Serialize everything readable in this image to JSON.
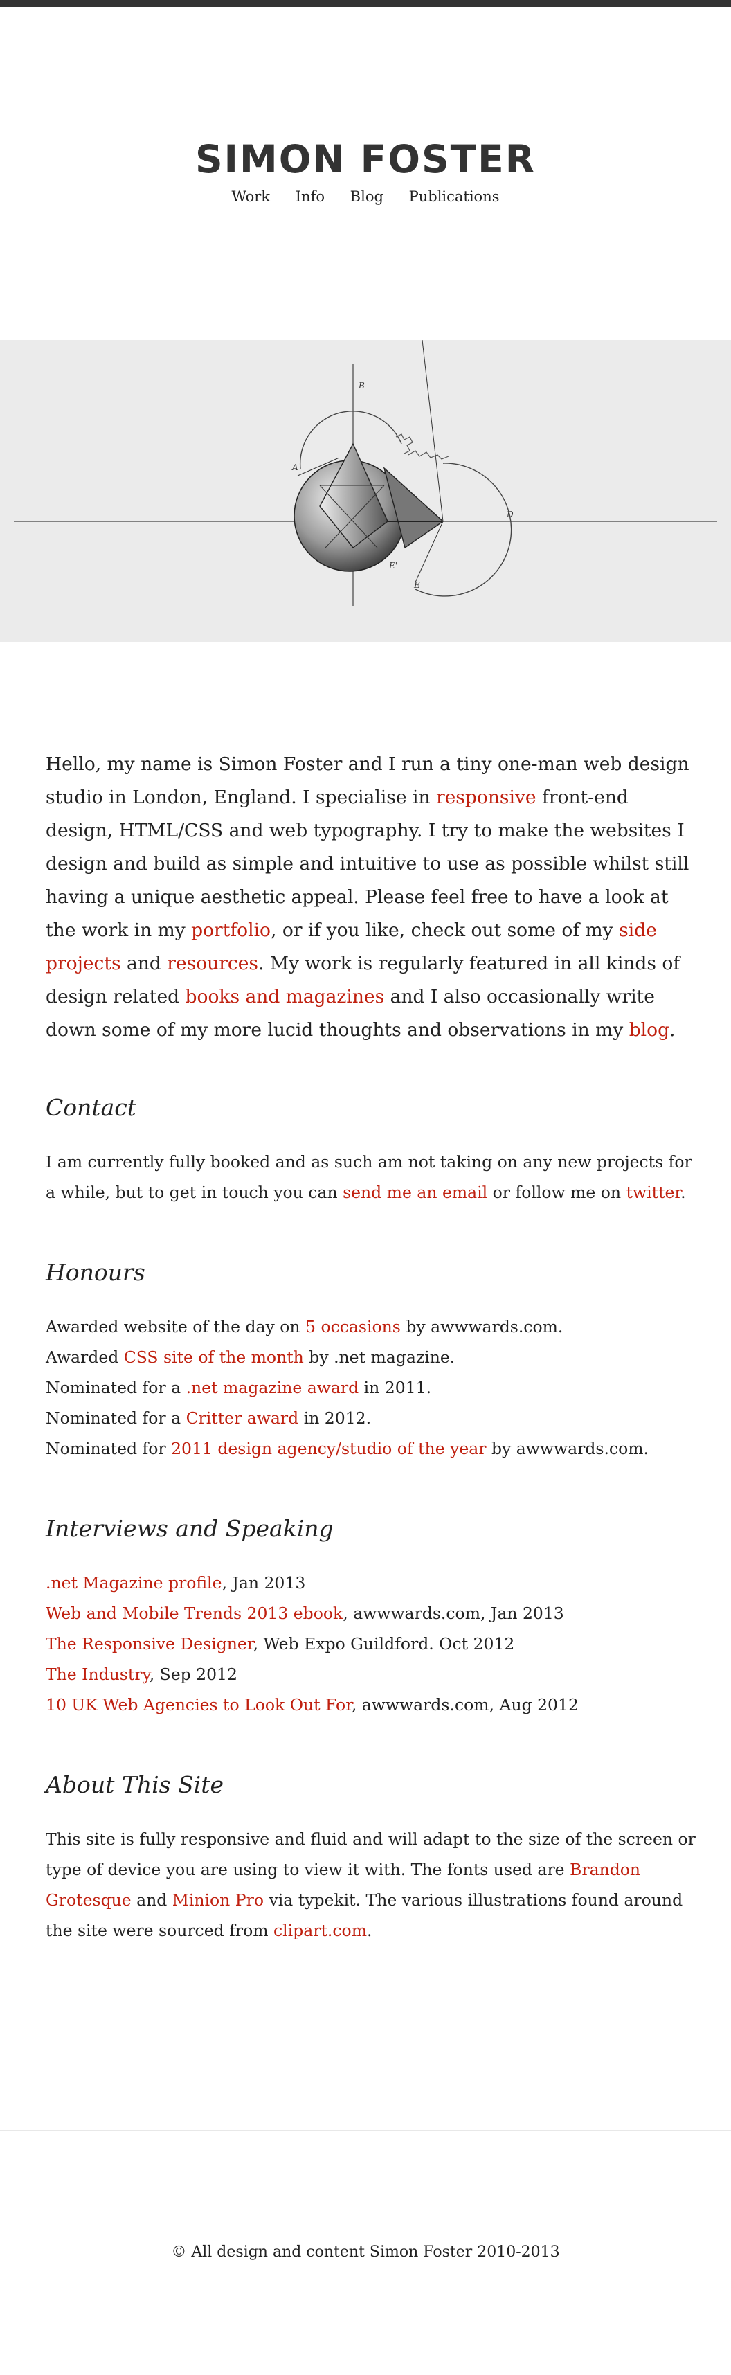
{
  "header": {
    "logo": "SIMON FOSTER",
    "nav": [
      "Work",
      "Info",
      "Blog",
      "Publications"
    ]
  },
  "hero": {
    "illustration": "geometric-cone-sphere-engraving",
    "labels": [
      "B",
      "A",
      "D",
      "E'",
      "E"
    ]
  },
  "intro": {
    "t1": "Hello, my name is Simon Foster and I run a tiny one-man web design studio in London, England. I specialise in ",
    "l1": "responsive",
    "t2": " front-end design, HTML/CSS and web typography. I try to make the websites I design and build as simple and intuitive to use as possible whilst still having a unique aesthetic appeal. Please feel free to have a look at the work in my ",
    "l2": "portfolio",
    "t3": ", or if you like, check out some of my ",
    "l3": "side projects",
    "t4": " and ",
    "l4": "resources",
    "t5": ". My work is regularly featured in all kinds of design related ",
    "l5": "books and magazines",
    "t6": " and I also occasionally write down some of my more lucid thoughts and observations in my ",
    "l6": "blog",
    "t7": "."
  },
  "contact": {
    "heading": "Contact",
    "t1": "I am currently fully booked and as such am not taking on any new projects for a while, but to get in touch you can ",
    "l1": "send me an email",
    "t2": " or follow me on ",
    "l2": "twitter",
    "t3": "."
  },
  "honours": {
    "heading": "Honours",
    "items": [
      {
        "pre": "Awarded website of the day on ",
        "link": "5 occasions",
        "post": " by awwwards.com."
      },
      {
        "pre": "Awarded ",
        "link": "CSS site of the month",
        "post": " by .net magazine."
      },
      {
        "pre": "Nominated for a ",
        "link": ".net magazine award",
        "post": " in 2011."
      },
      {
        "pre": "Nominated for a ",
        "link": "Critter award",
        "post": " in 2012."
      },
      {
        "pre": "Nominated for ",
        "link": "2011 design agency/studio of the year",
        "post": " by awwwards.com."
      }
    ]
  },
  "interviews": {
    "heading": "Interviews and Speaking",
    "items": [
      {
        "link": ".net Magazine profile",
        "post": ", Jan 2013"
      },
      {
        "link": "Web and Mobile Trends 2013 ebook",
        "post": ", awwwards.com, Jan 2013"
      },
      {
        "link": "The Responsive Designer",
        "post": ", Web Expo Guildford. Oct 2012"
      },
      {
        "link": "The Industry",
        "post": ", Sep 2012"
      },
      {
        "link": "10 UK Web Agencies to Look Out For",
        "post": ", awwwards.com, Aug 2012"
      }
    ]
  },
  "about": {
    "heading": "About This Site",
    "t1": "This site is fully responsive and fluid and will adapt to the size of the screen or type of device you are using to view it with. The fonts used are ",
    "l1": "Brandon Grotesque",
    "t2": " and ",
    "l2": "Minion Pro",
    "t3": " via typekit. The various illustrations found around the site were sourced from ",
    "l3": "clipart.com",
    "t4": "."
  },
  "footer": {
    "text": "© All design and content Simon Foster 2010-2013"
  },
  "colors": {
    "link": "#c0200f",
    "text": "#222222",
    "topbar": "#333333",
    "hero_bg": "#ebebeb"
  }
}
